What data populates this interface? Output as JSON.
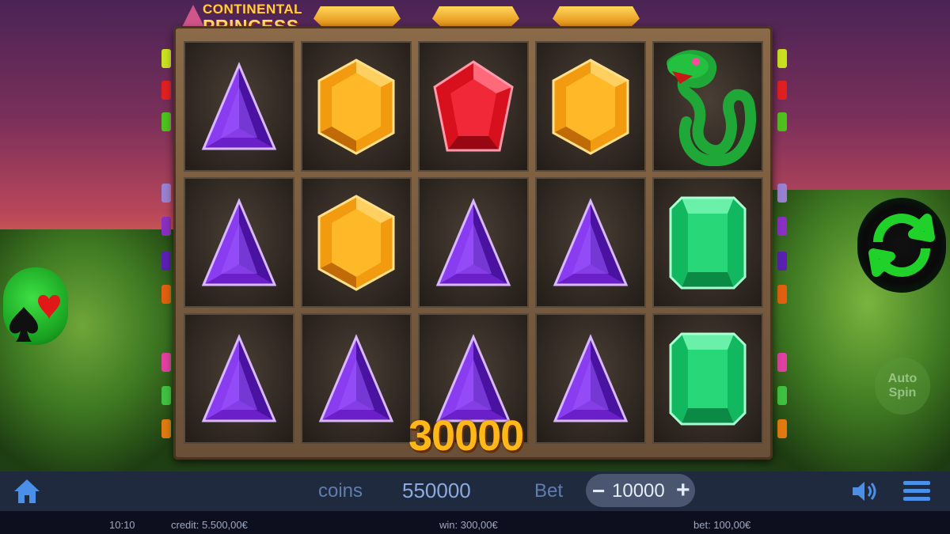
{
  "logo": {
    "line1": "CONTINENTAL",
    "line2": "PRINCESS"
  },
  "grid": [
    [
      "purple-triangle-gem",
      "orange-hexagon-gem",
      "red-pentagon-gem",
      "orange-hexagon-gem",
      "green-serpent-wild"
    ],
    [
      "purple-triangle-gem",
      "orange-hexagon-gem",
      "purple-triangle-gem",
      "purple-triangle-gem",
      "green-emerald-gem"
    ],
    [
      "purple-triangle-gem",
      "purple-triangle-gem",
      "purple-triangle-gem",
      "purple-triangle-gem",
      "green-emerald-gem"
    ]
  ],
  "win_amount": "30000",
  "controls": {
    "auto_spin_line1": "Auto",
    "auto_spin_line2": "Spin"
  },
  "bottom_bar": {
    "coins_label": "coins",
    "coins_value": "550000",
    "bet_label": "Bet",
    "bet_value": "10000",
    "bet_minus": "−",
    "bet_plus": "+"
  },
  "status_bar": {
    "time": "10:10",
    "credit": "credit: 5.500,00€",
    "win": "win: 300,00€",
    "bet": "bet: 100,00€"
  },
  "colors": {
    "accent_gold": "#ffb818",
    "bar_bg": "#202a3e",
    "spin_green": "#1fd128"
  }
}
